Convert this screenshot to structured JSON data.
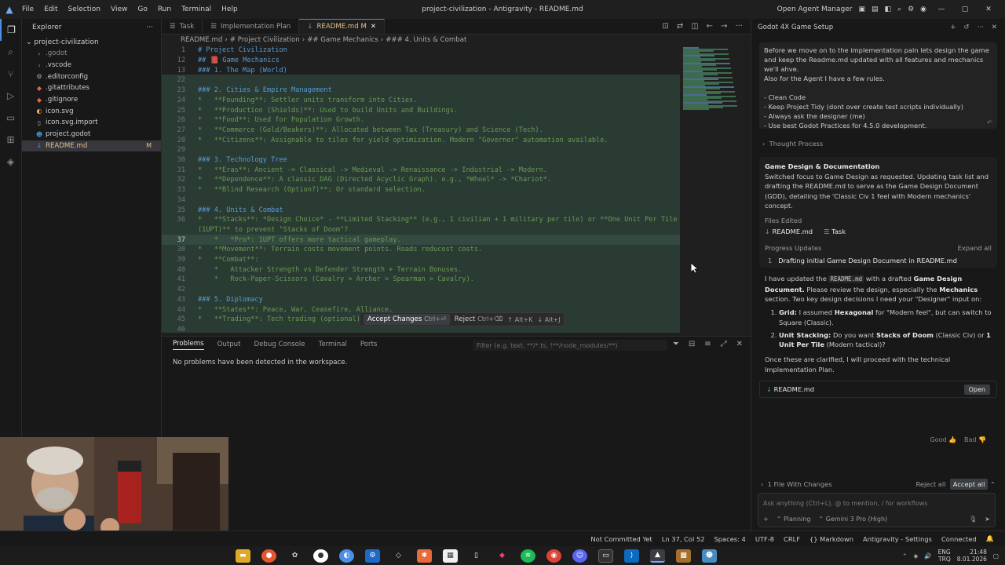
{
  "titlebar": {
    "menu": [
      "File",
      "Edit",
      "Selection",
      "View",
      "Go",
      "Run",
      "Terminal",
      "Help"
    ],
    "title": "project-civilization - Antigravity - README.md",
    "open_agent_manager": "Open Agent Manager"
  },
  "explorer": {
    "title": "Explorer",
    "root": "project-civilization",
    "items": [
      {
        "name": ".godot",
        "icon": "folder-icon",
        "dim": true
      },
      {
        "name": ".vscode",
        "icon": "folder-icon",
        "dim": false
      },
      {
        "name": ".editorconfig",
        "icon": "settings-icon",
        "dim": false
      },
      {
        "name": ".gitattributes",
        "icon": "git-icon",
        "dim": false
      },
      {
        "name": ".gitignore",
        "icon": "git-icon",
        "dim": false
      },
      {
        "name": "icon.svg",
        "icon": "svg-icon",
        "dim": false
      },
      {
        "name": "icon.svg.import",
        "icon": "file-icon",
        "dim": false
      },
      {
        "name": "project.godot",
        "icon": "godot-icon",
        "dim": false
      },
      {
        "name": "README.md",
        "icon": "markdown-icon",
        "dim": false,
        "badge": "M",
        "selected": true
      }
    ]
  },
  "tabs": [
    {
      "label": "Task",
      "active": false
    },
    {
      "label": "Implementation Plan",
      "active": false
    },
    {
      "label": "README.md M",
      "active": true
    }
  ],
  "breadcrumb": [
    "README.md",
    "# Project Civilization",
    "## Game Mechanics",
    "### 4. Units & Combat"
  ],
  "editor": {
    "lines": [
      {
        "n": "1",
        "t": "# Project Civilization",
        "c": "#569cd6"
      },
      {
        "n": "12",
        "t": "## 📕 Game Mechanics",
        "c": "#569cd6"
      },
      {
        "n": "13",
        "t": "### 1. The Map (World)",
        "c": "#569cd6"
      },
      {
        "n": "22",
        "t": "",
        "c": "#9cdcfe"
      },
      {
        "n": "23",
        "t": "### 2. Cities & Empire Management",
        "c": "#569cd6"
      },
      {
        "n": "24",
        "t": "*   **Founding**: Settler units transform into Cities.",
        "c": "#6a9955"
      },
      {
        "n": "25",
        "t": "*   **Production (Shields)**: Used to build Units and Buildings.",
        "c": "#6a9955"
      },
      {
        "n": "26",
        "t": "*   **Food**: Used for Population Growth.",
        "c": "#6a9955"
      },
      {
        "n": "27",
        "t": "*   **Commerce (Gold/Beakers)**: Allocated between Tax (Treasury) and Science (Tech).",
        "c": "#6a9955"
      },
      {
        "n": "28",
        "t": "*   **Citizens**: Assignable to tiles for yield optimization. Modern \"Governor\" automation available.",
        "c": "#6a9955"
      },
      {
        "n": "29",
        "t": "",
        "c": "#9cdcfe"
      },
      {
        "n": "30",
        "t": "### 3. Technology Tree",
        "c": "#569cd6"
      },
      {
        "n": "31",
        "t": "*   **Eras**: Ancient -> Classical -> Medieval -> Renaissance -> Industrial -> Modern.",
        "c": "#6a9955"
      },
      {
        "n": "32",
        "t": "*   **Dependence**: A classic DAG (Directed Acyclic Graph). e.g., *Wheel* -> *Chariot*.",
        "c": "#6a9955"
      },
      {
        "n": "33",
        "t": "*   **Blind Research (Option?)**: Or standard selection.",
        "c": "#6a9955"
      },
      {
        "n": "34",
        "t": "",
        "c": "#9cdcfe"
      },
      {
        "n": "35",
        "t": "### 4. Units & Combat",
        "c": "#569cd6"
      },
      {
        "n": "36",
        "t": "*   **Stacks**: *Design Choice* - **Limited Stacking** (e.g., 1 civilian + 1 military per tile) or **One Unit Per Tile",
        "c": "#6a9955"
      },
      {
        "n": "",
        "t": "(1UPT)** to prevent \"Stacks of Doom\"?",
        "c": "#6a9955"
      },
      {
        "n": "37",
        "t": "    *   *Pro*: 1UPT offers more tactical gameplay.",
        "c": "#6a9955"
      },
      {
        "n": "38",
        "t": "*   **Movement**: Terrain costs movement points. Roads reducest costs.",
        "c": "#6a9955"
      },
      {
        "n": "39",
        "t": "*   **Combat**:",
        "c": "#6a9955"
      },
      {
        "n": "40",
        "t": "    *   Attacker Strength vs Defender Strength + Terrain Bonuses.",
        "c": "#6a9955"
      },
      {
        "n": "41",
        "t": "    *   Rock-Paper-Scissors (Cavalry > Archer > Spearman > Cavalry).",
        "c": "#6a9955"
      },
      {
        "n": "42",
        "t": "",
        "c": "#9cdcfe"
      },
      {
        "n": "43",
        "t": "### 5. Diplomacy",
        "c": "#569cd6"
      },
      {
        "n": "44",
        "t": "*   **States**: Peace, War, Ceasefire, Alliance.",
        "c": "#6a9955"
      },
      {
        "n": "45",
        "t": "*   **Trading**: Tech trading (optional)",
        "c": "#6a9955"
      },
      {
        "n": "46",
        "t": "",
        "c": "#9cdcfe"
      }
    ]
  },
  "diffbar": {
    "accept": "Accept Changes",
    "accept_kbd": "Ctrl+⏎",
    "reject": "Reject",
    "reject_kbd": "Ctrl+⌫",
    "prev": "↑ Alt+K",
    "next": "↓ Alt+J"
  },
  "panel": {
    "tabs": [
      "Problems",
      "Output",
      "Debug Console",
      "Terminal",
      "Ports"
    ],
    "filter_placeholder": "Filter (e.g. text, **/*.ts, !**/node_modules/**)",
    "message": "No problems have been detected in the workspace."
  },
  "agent": {
    "title": "Godot 4X Game Setup",
    "user_message": [
      "Before we move on to the implementation paln lets design the game and keep the Readme.md updated with all features and mechanics we'll ahve.",
      "Also for the Agent I have a few rules.",
      "",
      "- Clean Code",
      "- Keep Project Tidy (dont over create test scripts individually)",
      "- Always ask the designer (me)",
      "- Use best Godot Practices for 4.5.0 development."
    ],
    "thought": "Thought Process",
    "card_title": "Game Design & Documentation",
    "card_body": "Switched focus to Game Design as requested. Updating task list and drafting the README.md to serve as the Game Design Document (GDD), detailing the 'Classic Civ 1 feel with Modern mechanics' concept.",
    "files_edited_label": "Files Edited",
    "files": [
      "README.md",
      "Task"
    ],
    "progress_label": "Progress Updates",
    "expand_all": "Expand all",
    "progress_item": "Drafting initial Game Design Document in README.md",
    "reply_intro_1": "I have updated the",
    "reply_code": "README.md",
    "reply_intro_2": "with a drafted",
    "reply_bold_1": "Game Design Document.",
    "reply_intro_3": "Please review the design, especially the",
    "reply_bold_2": "Mechanics",
    "reply_intro_4": "section. Two key design decisions I need your \"Designer\" input on:",
    "q1_label": "Grid:",
    "q1": "I assumed",
    "q1_b": "Hexagonal",
    "q1_rest": "for \"Modern feel\", but can switch to Square (Classic).",
    "q2_label": "Unit Stacking:",
    "q2": "Do you want",
    "q2_b": "Stacks of Doom",
    "q2_mid": "(Classic Civ) or",
    "q2_b2": "1 Unit Per Tile",
    "q2_rest": "(Modern tactical)?",
    "reply_end": "Once these are clarified, I will proceed with the technical Implementation Plan.",
    "file_card": "README.md",
    "open": "Open",
    "good": "Good",
    "bad": "Bad",
    "changes": "1 File With Changes",
    "reject_all": "Reject all",
    "accept_all": "Accept all",
    "input_placeholder": "Ask anything (Ctrl+L), @ to mention, / for workflows",
    "mode": "Planning",
    "model": "Gemini 3 Pro (High)"
  },
  "status": [
    "Not Committed Yet",
    "Ln 37, Col 52",
    "Spaces: 4",
    "UTF-8",
    "CRLF",
    "{} Markdown",
    "Antigravity - Settings",
    "Connected"
  ],
  "tray": {
    "lang": "ENG",
    "region": "TRQ",
    "time": "21:48",
    "date": "8.01.2026"
  }
}
